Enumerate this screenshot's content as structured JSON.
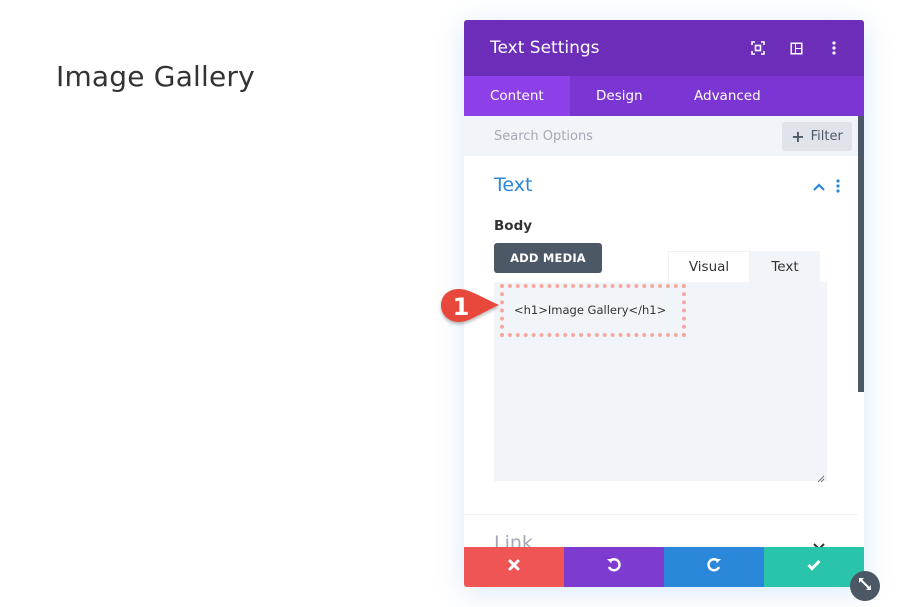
{
  "page": {
    "heading": "Image Gallery"
  },
  "modal": {
    "title": "Text Settings",
    "header_icons": [
      "focus-mode-icon",
      "split-view-icon",
      "more-options-icon"
    ],
    "tabs": [
      {
        "label": "Content",
        "active": true
      },
      {
        "label": "Design",
        "active": false
      },
      {
        "label": "Advanced",
        "active": false
      }
    ],
    "search": {
      "placeholder": "Search Options",
      "value": ""
    },
    "filter_label": "Filter",
    "sections": {
      "text": {
        "title": "Text",
        "expanded": true,
        "body_label": "Body",
        "add_media_label": "ADD MEDIA",
        "editor_tabs": [
          {
            "label": "Visual",
            "active": false
          },
          {
            "label": "Text",
            "active": true
          }
        ],
        "editor_content": "<h1>Image Gallery</h1>"
      },
      "link": {
        "title": "Link",
        "expanded": false
      }
    },
    "actions": [
      {
        "name": "discard",
        "icon": "close-icon",
        "color": "#ef5555"
      },
      {
        "name": "undo",
        "icon": "undo-icon",
        "color": "#7e3bd0"
      },
      {
        "name": "redo",
        "icon": "redo-icon",
        "color": "#2b87da"
      },
      {
        "name": "save",
        "icon": "check-icon",
        "color": "#29c4a9"
      }
    ]
  },
  "annotation": {
    "callout_number": "1",
    "callout_color": "#e8473a",
    "highlight_color": "#f4a9a0"
  },
  "colors": {
    "header": "#6c2eb9",
    "tabs_bar": "#7b35d2",
    "tab_active": "#8d3fe8",
    "section_title": "#2b87da",
    "dark_button": "#4c5866"
  }
}
